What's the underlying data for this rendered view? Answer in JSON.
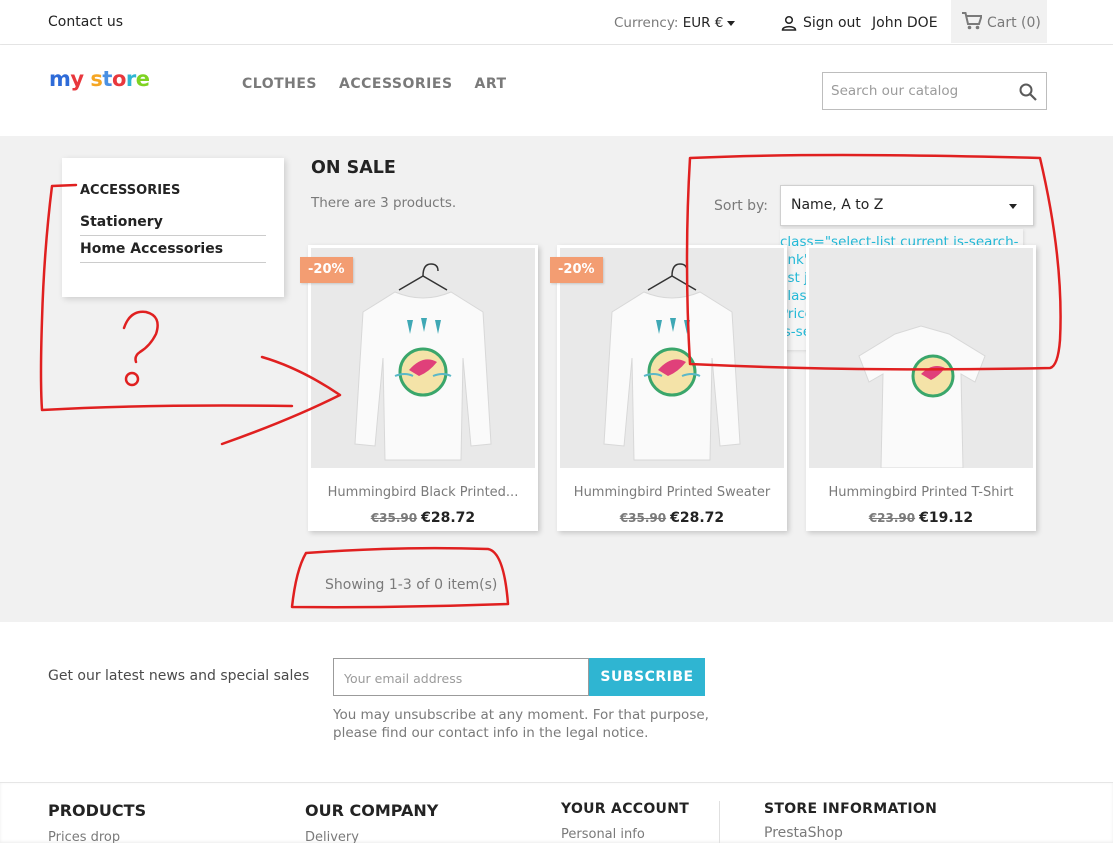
{
  "topbar": {
    "contact": "Contact us",
    "currency_label": "Currency:",
    "currency_value": "EUR €",
    "sign_out": "Sign out",
    "user_name": "John DOE",
    "cart": "Cart (0)"
  },
  "header": {
    "logo_letters": [
      {
        "ch": "m",
        "color": "#2e6bd8"
      },
      {
        "ch": "y",
        "color": "#e8383d"
      },
      {
        "ch": " ",
        "color": "#000000"
      },
      {
        "ch": "s",
        "color": "#f5a623"
      },
      {
        "ch": "t",
        "color": "#4a90e2"
      },
      {
        "ch": "o",
        "color": "#e8383d"
      },
      {
        "ch": "r",
        "color": "#2fb5d2"
      },
      {
        "ch": "e",
        "color": "#7ed321"
      }
    ],
    "nav": [
      "CLOTHES",
      "ACCESSORIES",
      "ART"
    ],
    "search_placeholder": "Search our catalog"
  },
  "sidebar": {
    "title": "ACCESSORIES",
    "items": [
      "Stationery",
      "Home Accessories"
    ]
  },
  "listing": {
    "title": "ON SALE",
    "count_text": "There are 3 products.",
    "sort_label": "Sort by:",
    "sort_value": "Name, A to Z",
    "dropdown_text": "class=\"select-list current js-search-link\" > Name, A to Z class=\"select-list js-search-link\" > Name, Z to A class=\"select-list js-search-link\" > Price, low to high class=\"select-list js-search-link\" > Price, high to low",
    "products": [
      {
        "name": "Hummingbird Black Printed...",
        "regular": "€35.90",
        "price": "€28.72",
        "badge": "-20%",
        "kind": "sweater"
      },
      {
        "name": "Hummingbird Printed Sweater",
        "regular": "€35.90",
        "price": "€28.72",
        "badge": "-20%",
        "kind": "sweater"
      },
      {
        "name": "Hummingbird Printed T-Shirt",
        "regular": "€23.90",
        "price": "€19.12",
        "badge": "",
        "kind": "tshirt"
      }
    ],
    "pagination": "Showing 1-3 of 0 item(s)"
  },
  "newsletter": {
    "label": "Get our latest news and special sales",
    "email_placeholder": "Your email address",
    "subscribe": "SUBSCRIBE",
    "note": "You may unsubscribe at any moment. For that purpose, please find our contact info in the legal notice."
  },
  "footer": {
    "products_title": "PRODUCTS",
    "products_link": "Prices drop",
    "company_title": "OUR COMPANY",
    "company_link": "Delivery",
    "account_title": "YOUR ACCOUNT",
    "account_link": "Personal info",
    "store_title": "STORE INFORMATION",
    "store_link": "PrestaShop"
  },
  "annotation": {
    "question_mark": "?",
    "color": "#e02020"
  },
  "colors": {
    "accent": "#2fb5d2",
    "discount": "#f39d72"
  }
}
